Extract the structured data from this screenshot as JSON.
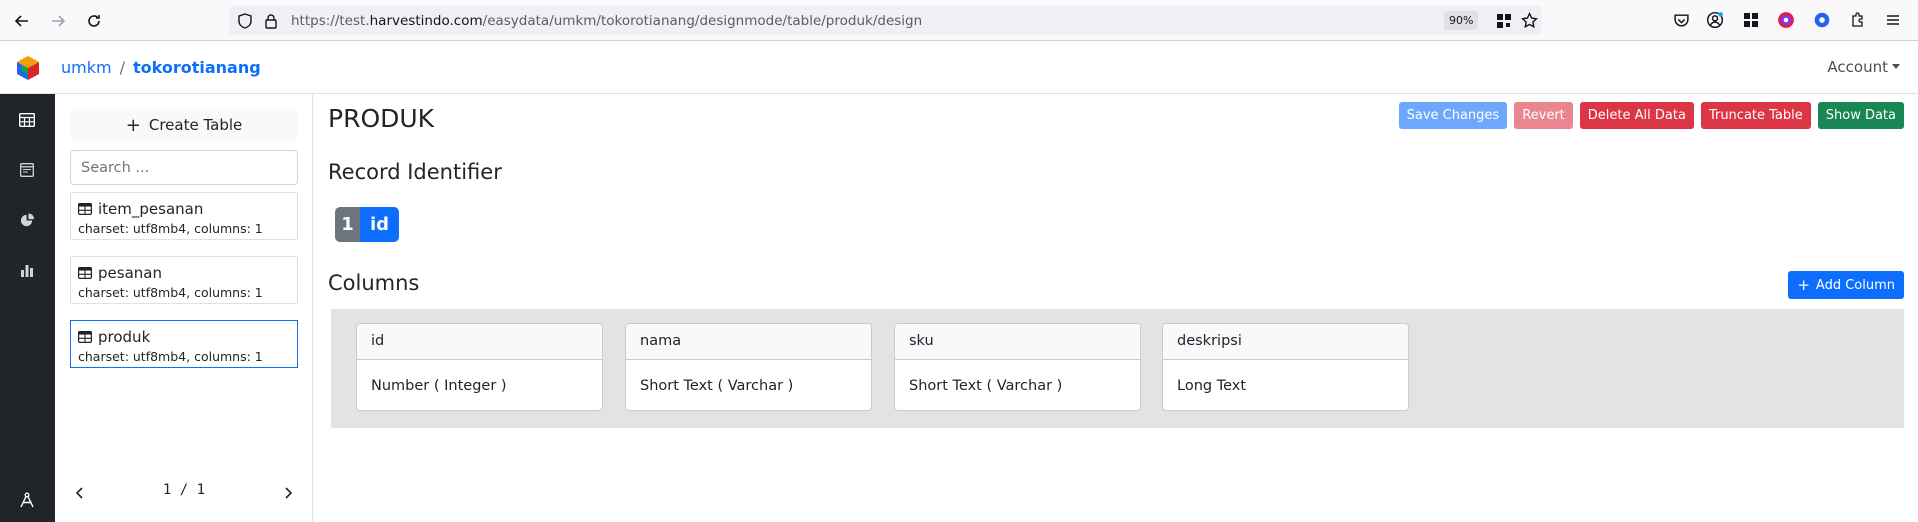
{
  "browser": {
    "url_prefix": "https://test.",
    "url_host": "harvestindo.com",
    "url_path": "/easydata/umkm/tokorotianang/designmode/table/produk/design",
    "zoom": "90%"
  },
  "header": {
    "breadcrumb": [
      "umkm",
      "tokorotianang"
    ],
    "breadcrumb_sep": "/",
    "account_label": "Account"
  },
  "sidebar": {
    "create_label": "Create Table",
    "search_placeholder": "Search ...",
    "tables": [
      {
        "name": "item_pesanan",
        "meta": "charset: utf8mb4, columns: 1"
      },
      {
        "name": "pesanan",
        "meta": "charset: utf8mb4, columns: 1"
      },
      {
        "name": "produk",
        "meta": "charset: utf8mb4, columns: 1"
      }
    ],
    "pager": "1 / 1"
  },
  "main": {
    "title": "PRODUK",
    "actions": {
      "save": "Save Changes",
      "revert": "Revert",
      "delete_all": "Delete All Data",
      "truncate": "Truncate Table",
      "show_data": "Show Data"
    },
    "record_identifier_title": "Record Identifier",
    "record_identifier": {
      "index": "1",
      "name": "id"
    },
    "columns_title": "Columns",
    "add_column_label": "Add Column",
    "columns": [
      {
        "name": "id",
        "type": "Number ( Integer )"
      },
      {
        "name": "nama",
        "type": "Short Text ( Varchar )"
      },
      {
        "name": "sku",
        "type": "Short Text ( Varchar )"
      },
      {
        "name": "deskripsi",
        "type": "Long Text"
      }
    ]
  }
}
